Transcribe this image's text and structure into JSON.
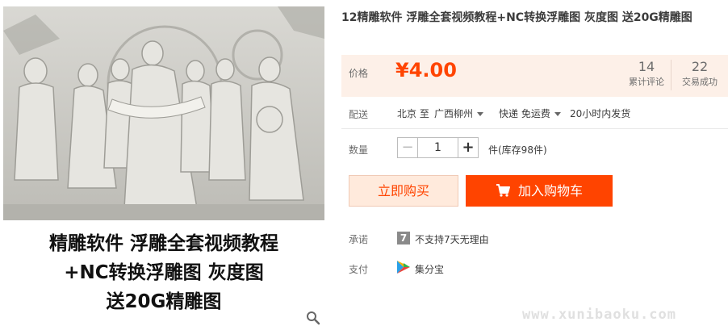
{
  "product": {
    "title": "12精雕软件 浮雕全套视频教程+NC转换浮雕图 灰度图 送20G精雕图",
    "image_caption": [
      "精雕软件 浮雕全套视频教程",
      "+NC转换浮雕图 灰度图",
      "送20G精雕图"
    ],
    "image_icon": "relief-sculpture-image"
  },
  "price": {
    "label": "价格",
    "value": "¥4.00"
  },
  "stats": [
    {
      "num": "14",
      "caption": "累计评论"
    },
    {
      "num": "22",
      "caption": "交易成功"
    }
  ],
  "delivery": {
    "label": "配送",
    "from": "北京 至",
    "to": "广西柳州",
    "method": "快递 免运费",
    "ship_time": "20小时内发货"
  },
  "quantity": {
    "label": "数量",
    "minus": "−",
    "value": "1",
    "plus": "+",
    "stock": "件(库存98件)"
  },
  "buttons": {
    "buy_now": "立即购买",
    "add_to_cart": "加入购物车"
  },
  "promise": {
    "label": "承诺",
    "badge": "7",
    "text": "不支持7天无理由"
  },
  "payment": {
    "label": "支付",
    "method": "集分宝"
  },
  "watermark": "www.xunibaoku.com",
  "colors": {
    "accent": "#ff4400",
    "price_bg": "#fdf0e8",
    "buy_bg": "#ffeadc"
  }
}
